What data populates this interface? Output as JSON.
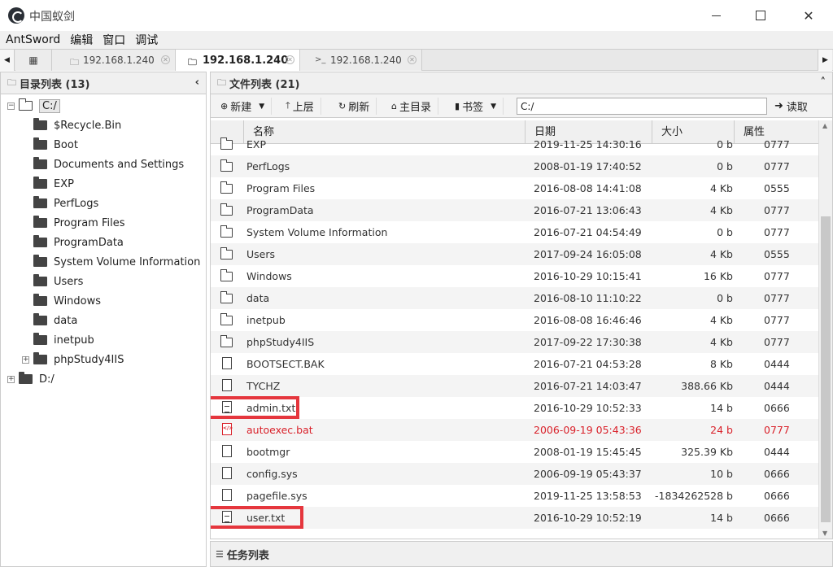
{
  "window": {
    "title": "中国蚁剑"
  },
  "menu": [
    "AntSword",
    "编辑",
    "窗口",
    "调试"
  ],
  "tabs": [
    {
      "label": "192.168.1.240",
      "icon": "folder-icon"
    },
    {
      "label": "192.168.1.240",
      "icon": "folder-icon",
      "active": true
    },
    {
      "label": "192.168.1.240",
      "icon": "terminal-icon"
    }
  ],
  "left_panel": {
    "title": "目录列表 (13)",
    "root": "C:/",
    "items": [
      "$Recycle.Bin",
      "Boot",
      "Documents and Settings",
      "EXP",
      "PerfLogs",
      "Program Files",
      "ProgramData",
      "System Volume Information",
      "Users",
      "Windows",
      "data",
      "inetpub",
      "phpStudy4IIS"
    ],
    "other_root": "D:/"
  },
  "right_panel": {
    "title": "文件列表 (21)",
    "toolbar": {
      "new": "新建",
      "up": "上层",
      "refresh": "刷新",
      "home": "主目录",
      "bookmark": "书签",
      "path": "C:/",
      "read": "读取"
    },
    "columns": [
      "名称",
      "日期",
      "大小",
      "属性"
    ],
    "files": [
      {
        "name": "EXP",
        "date": "2019-11-25 14:30:16",
        "size": "0 b",
        "attr": "0777",
        "type": "folder"
      },
      {
        "name": "PerfLogs",
        "date": "2008-01-19 17:40:52",
        "size": "0 b",
        "attr": "0777",
        "type": "folder"
      },
      {
        "name": "Program Files",
        "date": "2016-08-08 14:41:08",
        "size": "4 Kb",
        "attr": "0555",
        "type": "folder"
      },
      {
        "name": "ProgramData",
        "date": "2016-07-21 13:06:43",
        "size": "4 Kb",
        "attr": "0777",
        "type": "folder"
      },
      {
        "name": "System Volume Information",
        "date": "2016-07-21 04:54:49",
        "size": "0 b",
        "attr": "0777",
        "type": "folder"
      },
      {
        "name": "Users",
        "date": "2017-09-24 16:05:08",
        "size": "4 Kb",
        "attr": "0555",
        "type": "folder"
      },
      {
        "name": "Windows",
        "date": "2016-10-29 10:15:41",
        "size": "16 Kb",
        "attr": "0777",
        "type": "folder"
      },
      {
        "name": "data",
        "date": "2016-08-10 11:10:22",
        "size": "0 b",
        "attr": "0777",
        "type": "folder"
      },
      {
        "name": "inetpub",
        "date": "2016-08-08 16:46:46",
        "size": "4 Kb",
        "attr": "0777",
        "type": "folder"
      },
      {
        "name": "phpStudy4IIS",
        "date": "2017-09-22 17:30:38",
        "size": "4 Kb",
        "attr": "0777",
        "type": "folder"
      },
      {
        "name": "BOOTSECT.BAK",
        "date": "2016-07-21 04:53:28",
        "size": "8 Kb",
        "attr": "0444",
        "type": "file"
      },
      {
        "name": "TYCHZ",
        "date": "2016-07-21 14:03:47",
        "size": "388.66 Kb",
        "attr": "0444",
        "type": "file"
      },
      {
        "name": "admin.txt",
        "date": "2016-10-29 10:52:33",
        "size": "14 b",
        "attr": "0666",
        "type": "txt"
      },
      {
        "name": "autoexec.bat",
        "date": "2006-09-19 05:43:36",
        "size": "24 b",
        "attr": "0777",
        "type": "bat"
      },
      {
        "name": "bootmgr",
        "date": "2008-01-19 15:45:45",
        "size": "325.39 Kb",
        "attr": "0444",
        "type": "file"
      },
      {
        "name": "config.sys",
        "date": "2006-09-19 05:43:37",
        "size": "10 b",
        "attr": "0666",
        "type": "file"
      },
      {
        "name": "pagefile.sys",
        "date": "2019-11-25 13:58:53",
        "size": "-1834262528 b",
        "attr": "0666",
        "type": "file"
      },
      {
        "name": "user.txt",
        "date": "2016-10-29 10:52:19",
        "size": "14 b",
        "attr": "0666",
        "type": "txt"
      }
    ]
  },
  "task_panel": {
    "title": "任务列表"
  },
  "colors": {
    "highlight": "#e5363d",
    "danger_text": "#d9212a"
  }
}
